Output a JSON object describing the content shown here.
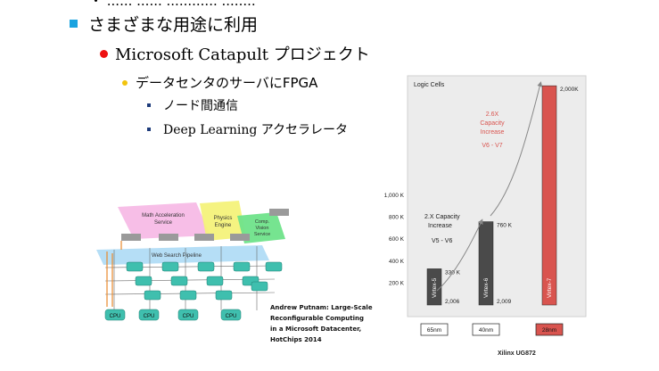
{
  "slide": {
    "top_cut_text": "・ ...... ...... ............ ........",
    "bullet1": "さまざまな用途に利用",
    "bullet2": "Microsoft Catapult プロジェクト",
    "bullet3": "データセンタのサーバにFPGA",
    "bullet4a": "ノード間通信",
    "bullet4b": "Deep Learning アクセラレータ"
  },
  "diagram": {
    "math_label_1": "Math Acceleration",
    "math_label_2": "Service",
    "physics_label_1": "Physics",
    "physics_label_2": "Engine",
    "vision_label_1": "Comp.",
    "vision_label_2": "Vision",
    "vision_label_3": "Service",
    "pipeline_label": "Web Search Pipeline",
    "cpu_label": "CPU"
  },
  "citation": {
    "line1": "Andrew Putnam: Large-Scale",
    "line2": "Reconfigurable Computing",
    "line3": "in a Microsoft Datacenter,",
    "line4": "HotChips 2014"
  },
  "chart_data": {
    "type": "bar",
    "title": "Logic Cells",
    "categories": [
      "65nm",
      "40nm",
      "28nm"
    ],
    "series": [
      {
        "name": "Virtex-5",
        "values": [
          330
        ]
      },
      {
        "name": "Virtex-6",
        "values": [
          760
        ]
      },
      {
        "name": "Virtex-7",
        "values": [
          2000
        ]
      }
    ],
    "bars": [
      {
        "label": "Virtex-5",
        "node": "65nm",
        "value": 330,
        "value_label": "330 K",
        "year": "2,006",
        "color": "#4a4a4a"
      },
      {
        "label": "Virtex-6",
        "node": "40nm",
        "value": 760,
        "value_label": "760 K",
        "year": "2,009",
        "color": "#4a4a4a"
      },
      {
        "label": "Virtex-7",
        "node": "28nm",
        "value": 2000,
        "value_label": "2,000K",
        "year": "",
        "color": "#d9544f"
      }
    ],
    "yticks": [
      {
        "value": 200,
        "label": "200 K"
      },
      {
        "value": 400,
        "label": "400 K"
      },
      {
        "value": 600,
        "label": "600 K"
      },
      {
        "value": 800,
        "label": "800 K"
      },
      {
        "value": 1000,
        "label": "1,000 K"
      }
    ],
    "ylim": [
      0,
      2050
    ],
    "annotations": {
      "a1_line1": "2.X Capacity",
      "a1_line2": "Increase",
      "a1_line3": "V5 - V6",
      "a2_line1": "2.6X",
      "a2_line2": "Capacity",
      "a2_line3": "Increase",
      "a2_line4": "V6 - V7"
    },
    "source": "Xilinx UG872"
  }
}
